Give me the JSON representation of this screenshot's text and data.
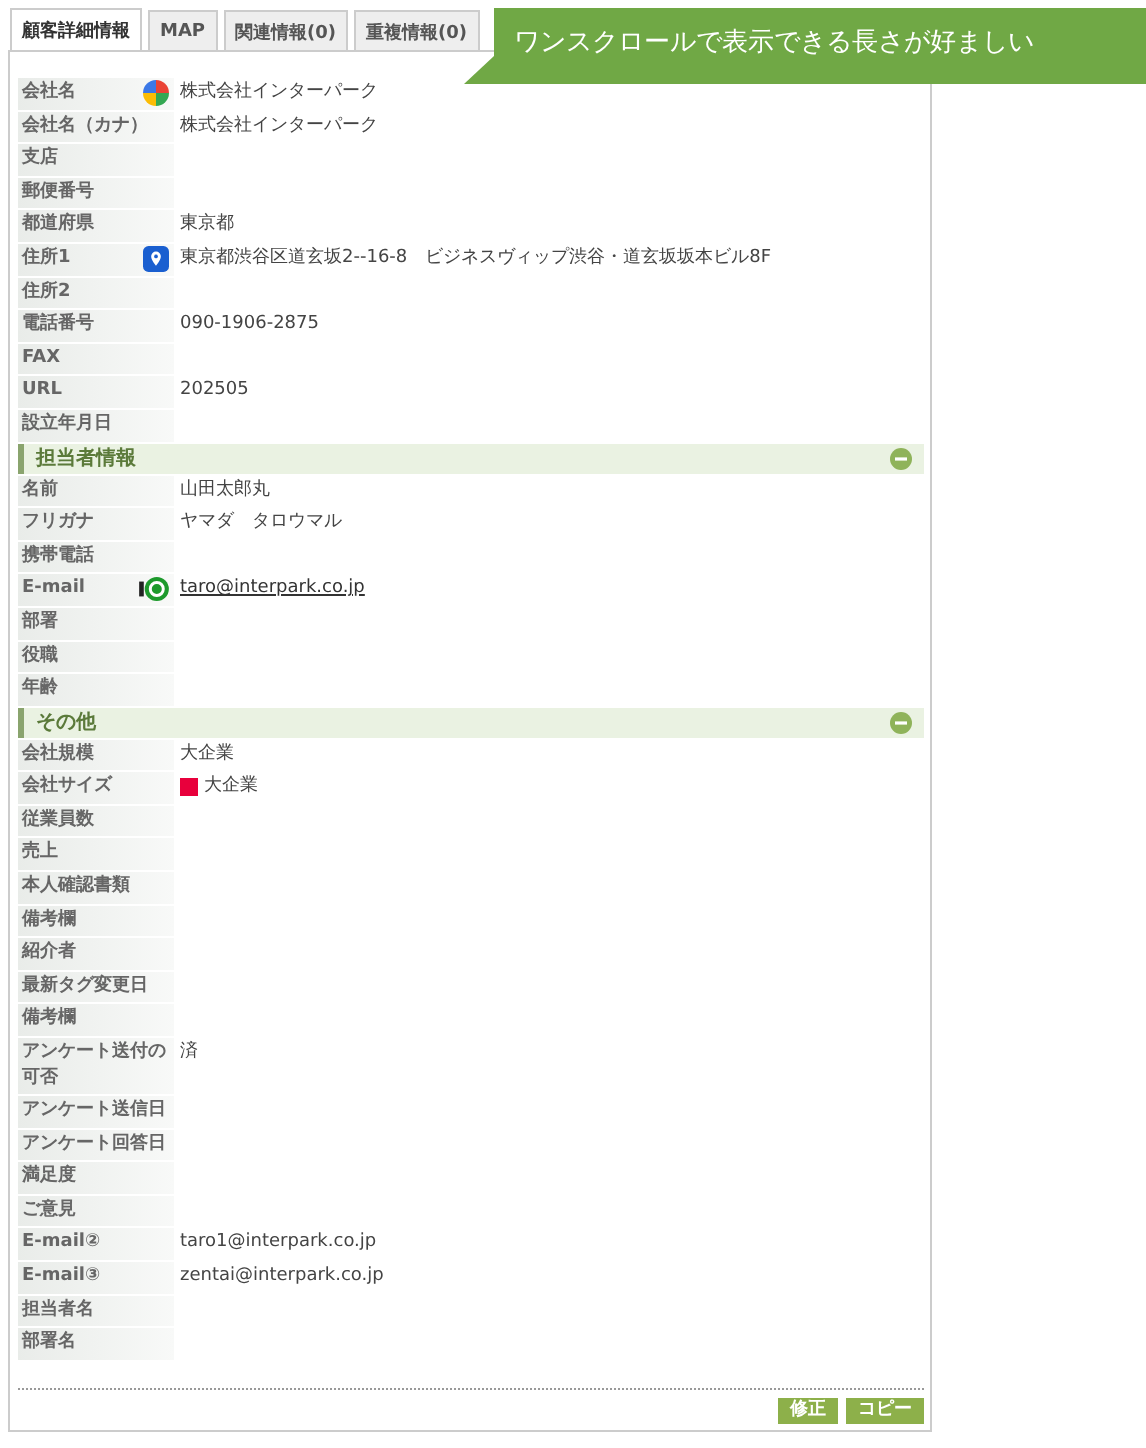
{
  "tabs": [
    {
      "label": "顧客詳細情報",
      "selected": true
    },
    {
      "label": "MAP",
      "selected": false
    },
    {
      "label": "関連情報(0)",
      "selected": false
    },
    {
      "label": "重複情報(0)",
      "selected": false
    }
  ],
  "callout": {
    "text": "ワンスクロールで表示できる長さが好ましい"
  },
  "sections": [
    {
      "rows": [
        {
          "label": "会社名",
          "kind": "contacts",
          "value": "株式会社インターパーク"
        },
        {
          "label": "会社名（カナ）",
          "value": "株式会社インターパーク"
        },
        {
          "label": "支店"
        },
        {
          "label": "郵便番号"
        },
        {
          "label": "都道府県",
          "value": "東京都"
        },
        {
          "label": "住所1",
          "kind": "map",
          "value": "東京都渋谷区道玄坂2--16-8　ビジネスヴィップ渋谷・道玄坂坂本ビル8F"
        },
        {
          "label": "住所2"
        },
        {
          "label": "電話番号",
          "value": "090-1906-2875"
        },
        {
          "label": "FAX"
        },
        {
          "label": "URL",
          "value": "202505"
        },
        {
          "label": "設立年月日"
        }
      ]
    },
    {
      "title": "担当者情報",
      "expanded": true,
      "rows": [
        {
          "label": "名前",
          "value": "山田太郎丸"
        },
        {
          "label": "フリガナ",
          "value": "ヤマダ　タロウマル"
        },
        {
          "label": "携帯電話"
        },
        {
          "label": "E-mail",
          "kind": "mail-ok",
          "value": "taro@interpark.co.jp",
          "link": true
        },
        {
          "label": "部署"
        },
        {
          "label": "役職"
        },
        {
          "label": "年齢"
        }
      ]
    },
    {
      "title": "その他",
      "expanded": true,
      "rows": [
        {
          "label": "会社規模",
          "value": "大企業"
        },
        {
          "label": "会社サイズ",
          "value": "大企業",
          "color": "#e8003c"
        },
        {
          "label": "従業員数"
        },
        {
          "label": "売上"
        },
        {
          "label": "本人確認書類"
        },
        {
          "label": "備考欄"
        },
        {
          "label": "紹介者"
        },
        {
          "label": "最新タグ変更日"
        },
        {
          "label": "備考欄"
        },
        {
          "label": "アンケート送付の可否",
          "value": "済"
        },
        {
          "label": "アンケート送信日"
        },
        {
          "label": "アンケート回答日"
        },
        {
          "label": "満足度"
        },
        {
          "label": "ご意見"
        },
        {
          "label": "E-mail②",
          "value": "taro1@interpark.co.jp"
        },
        {
          "label": "E-mail③",
          "value": "zentai@interpark.co.jp"
        },
        {
          "label": "担当者名"
        },
        {
          "label": "部署名"
        }
      ]
    }
  ],
  "buttons": [
    "修正",
    "コピー"
  ]
}
